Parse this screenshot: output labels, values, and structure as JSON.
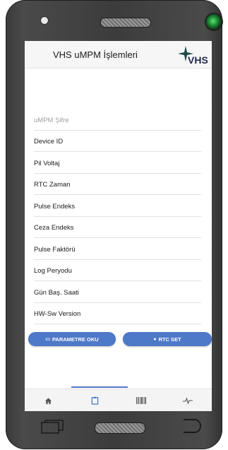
{
  "header": {
    "title": "VHS uMPM İşlemleri",
    "logo_text": "VHS"
  },
  "list": {
    "items": [
      {
        "label": "uMPM Şifre",
        "placeholder": true
      },
      {
        "label": "Device ID"
      },
      {
        "label": "Pil Voltaj"
      },
      {
        "label": "RTC Zaman"
      },
      {
        "label": "Pulse Endeks"
      },
      {
        "label": "Ceza Endeks"
      },
      {
        "label": "Pulse Faktörü"
      },
      {
        "label": "Log Peryodu"
      },
      {
        "label": "Gün Baş. Saati"
      },
      {
        "label": "HW-Sw Version"
      }
    ]
  },
  "buttons": {
    "read_params": "PARAMETRE OKU",
    "rtc_set": "RTC SET"
  },
  "tabs": [
    {
      "icon": "home-icon"
    },
    {
      "icon": "clipboard-icon",
      "active": true
    },
    {
      "icon": "barcode-icon"
    },
    {
      "icon": "pulse-icon"
    }
  ],
  "colors": {
    "accent": "#4e78c8",
    "header_bg": "#f6f6f6",
    "frame": "#3c3c3c"
  }
}
